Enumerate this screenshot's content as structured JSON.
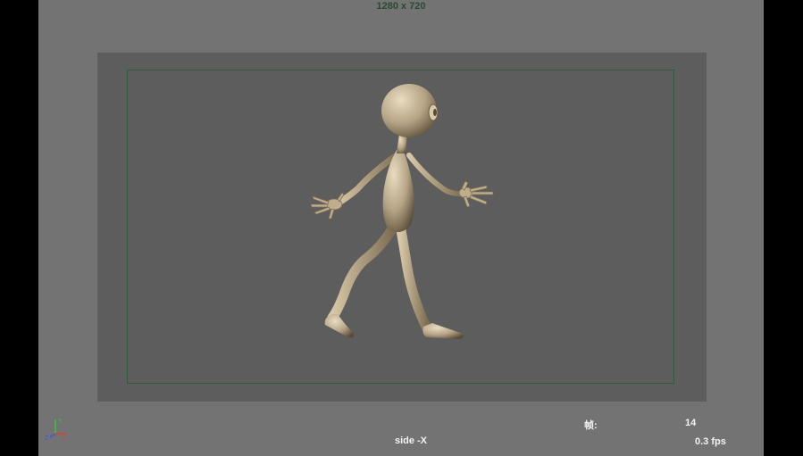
{
  "viewport": {
    "resolution_label": "1280 x 720",
    "camera_label": "side -X",
    "frame_label": "帧:",
    "frame_value": "14",
    "fps_label": "0.3 fps"
  },
  "axis_indicator": {
    "labels": [
      "Z",
      "Y",
      "X"
    ],
    "colors": {
      "x": "#e0402a",
      "y": "#35c43c",
      "z": "#3a57e8"
    }
  },
  "colors": {
    "viewport_background": "#737373",
    "film_gate": "#5d5d5d",
    "resolution_gate_border": "#2f5a3d",
    "character_skin": "#b5a385",
    "letterbox": "#000000"
  }
}
